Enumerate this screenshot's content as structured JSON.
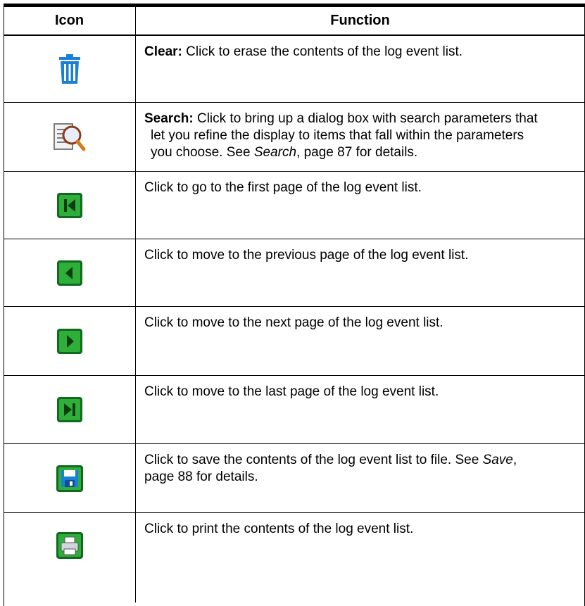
{
  "header": {
    "icon_col": "Icon",
    "function_col": "Function"
  },
  "rows": [
    {
      "icon": "trash-icon",
      "bold": "Clear:",
      "text": " Click to erase the contents of the log event list."
    },
    {
      "icon": "search-log-icon",
      "bold": "Search:",
      "text": " Click to bring up a dialog box with search parameters that",
      "line2": "let you refine the display to items that fall within the parameters",
      "line3_pre": "you choose. See ",
      "line3_em": "Search",
      "line3_post": ", page 87 for details."
    },
    {
      "icon": "first-page-icon",
      "text": "Click to go to the first page of the log event list."
    },
    {
      "icon": "previous-page-icon",
      "text": "Click to move to the previous page of the log event list."
    },
    {
      "icon": "next-page-icon",
      "text": "Click to move to the next page of the log event list."
    },
    {
      "icon": "last-page-icon",
      "text": "Click to move to the last page of the log event list."
    },
    {
      "icon": "save-icon",
      "text_pre": "Click to save the contents of the log event list to file. See ",
      "text_em": "Save",
      "text_post": ",",
      "line2": "page 88 for details."
    },
    {
      "icon": "print-icon",
      "text": "Click to print the contents of the log event list."
    }
  ],
  "colors": {
    "green_dark": "#0f6a1f",
    "green": "#2fae3a",
    "blue": "#1c7fd6"
  }
}
